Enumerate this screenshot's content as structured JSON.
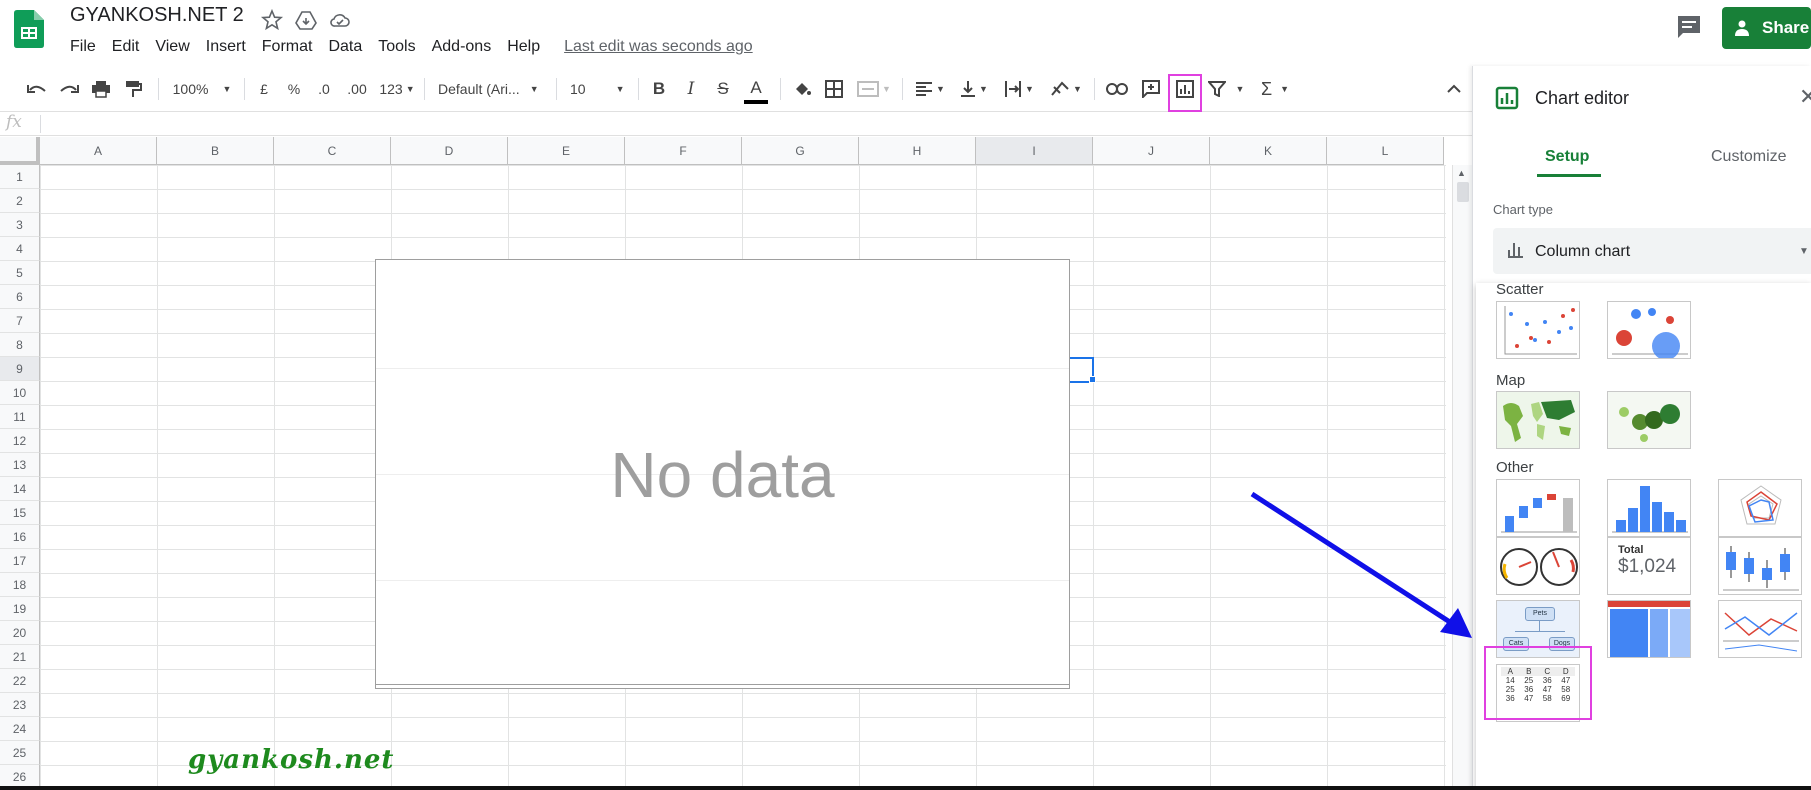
{
  "doc": {
    "title": "GYANKOSH.NET 2",
    "last_edit": "Last edit was seconds ago",
    "share_label": "Share"
  },
  "menu": [
    "File",
    "Edit",
    "View",
    "Insert",
    "Format",
    "Data",
    "Tools",
    "Add-ons",
    "Help"
  ],
  "toolbar": {
    "zoom": "100%",
    "currency": "£",
    "percent": "%",
    "dec_decrease": ".0",
    "dec_increase": ".00",
    "number_format": "123",
    "font": "Default (Ari...",
    "font_size": "10",
    "bold": "B",
    "italic": "I",
    "strike": "S",
    "text_color": "A",
    "sum": "Σ"
  },
  "formula": {
    "fx": "fx"
  },
  "columns": [
    "A",
    "B",
    "C",
    "D",
    "E",
    "F",
    "G",
    "H",
    "I",
    "J",
    "K",
    "L"
  ],
  "rows": [
    "1",
    "2",
    "3",
    "4",
    "5",
    "6",
    "7",
    "8",
    "9",
    "10",
    "11",
    "12",
    "13",
    "14",
    "15",
    "16",
    "17",
    "18",
    "19",
    "20",
    "21",
    "22",
    "23",
    "24",
    "25",
    "26"
  ],
  "chart": {
    "placeholder": "No data"
  },
  "watermark": "gyankosh.net",
  "chart_editor": {
    "title": "Chart editor",
    "tabs": [
      "Setup",
      "Customize"
    ],
    "chart_type_label": "Chart type",
    "chart_type_value": "Column chart",
    "sections": [
      "Scatter",
      "Map",
      "Other"
    ],
    "scorecard_label": "Total",
    "scorecard_value": "$1,024",
    "org_labels": [
      "Pets",
      "Cats",
      "Dogs"
    ],
    "table_headers": [
      "A",
      "B",
      "C",
      "D"
    ],
    "table_rows": [
      [
        "14",
        "25",
        "36",
        "47"
      ],
      [
        "25",
        "36",
        "47",
        "58"
      ],
      [
        "36",
        "47",
        "58",
        "69"
      ]
    ]
  },
  "colors": {
    "accent_green": "#188038",
    "highlight": "#e040e0",
    "arrow": "#1010e8",
    "selection": "#1a73e8"
  }
}
